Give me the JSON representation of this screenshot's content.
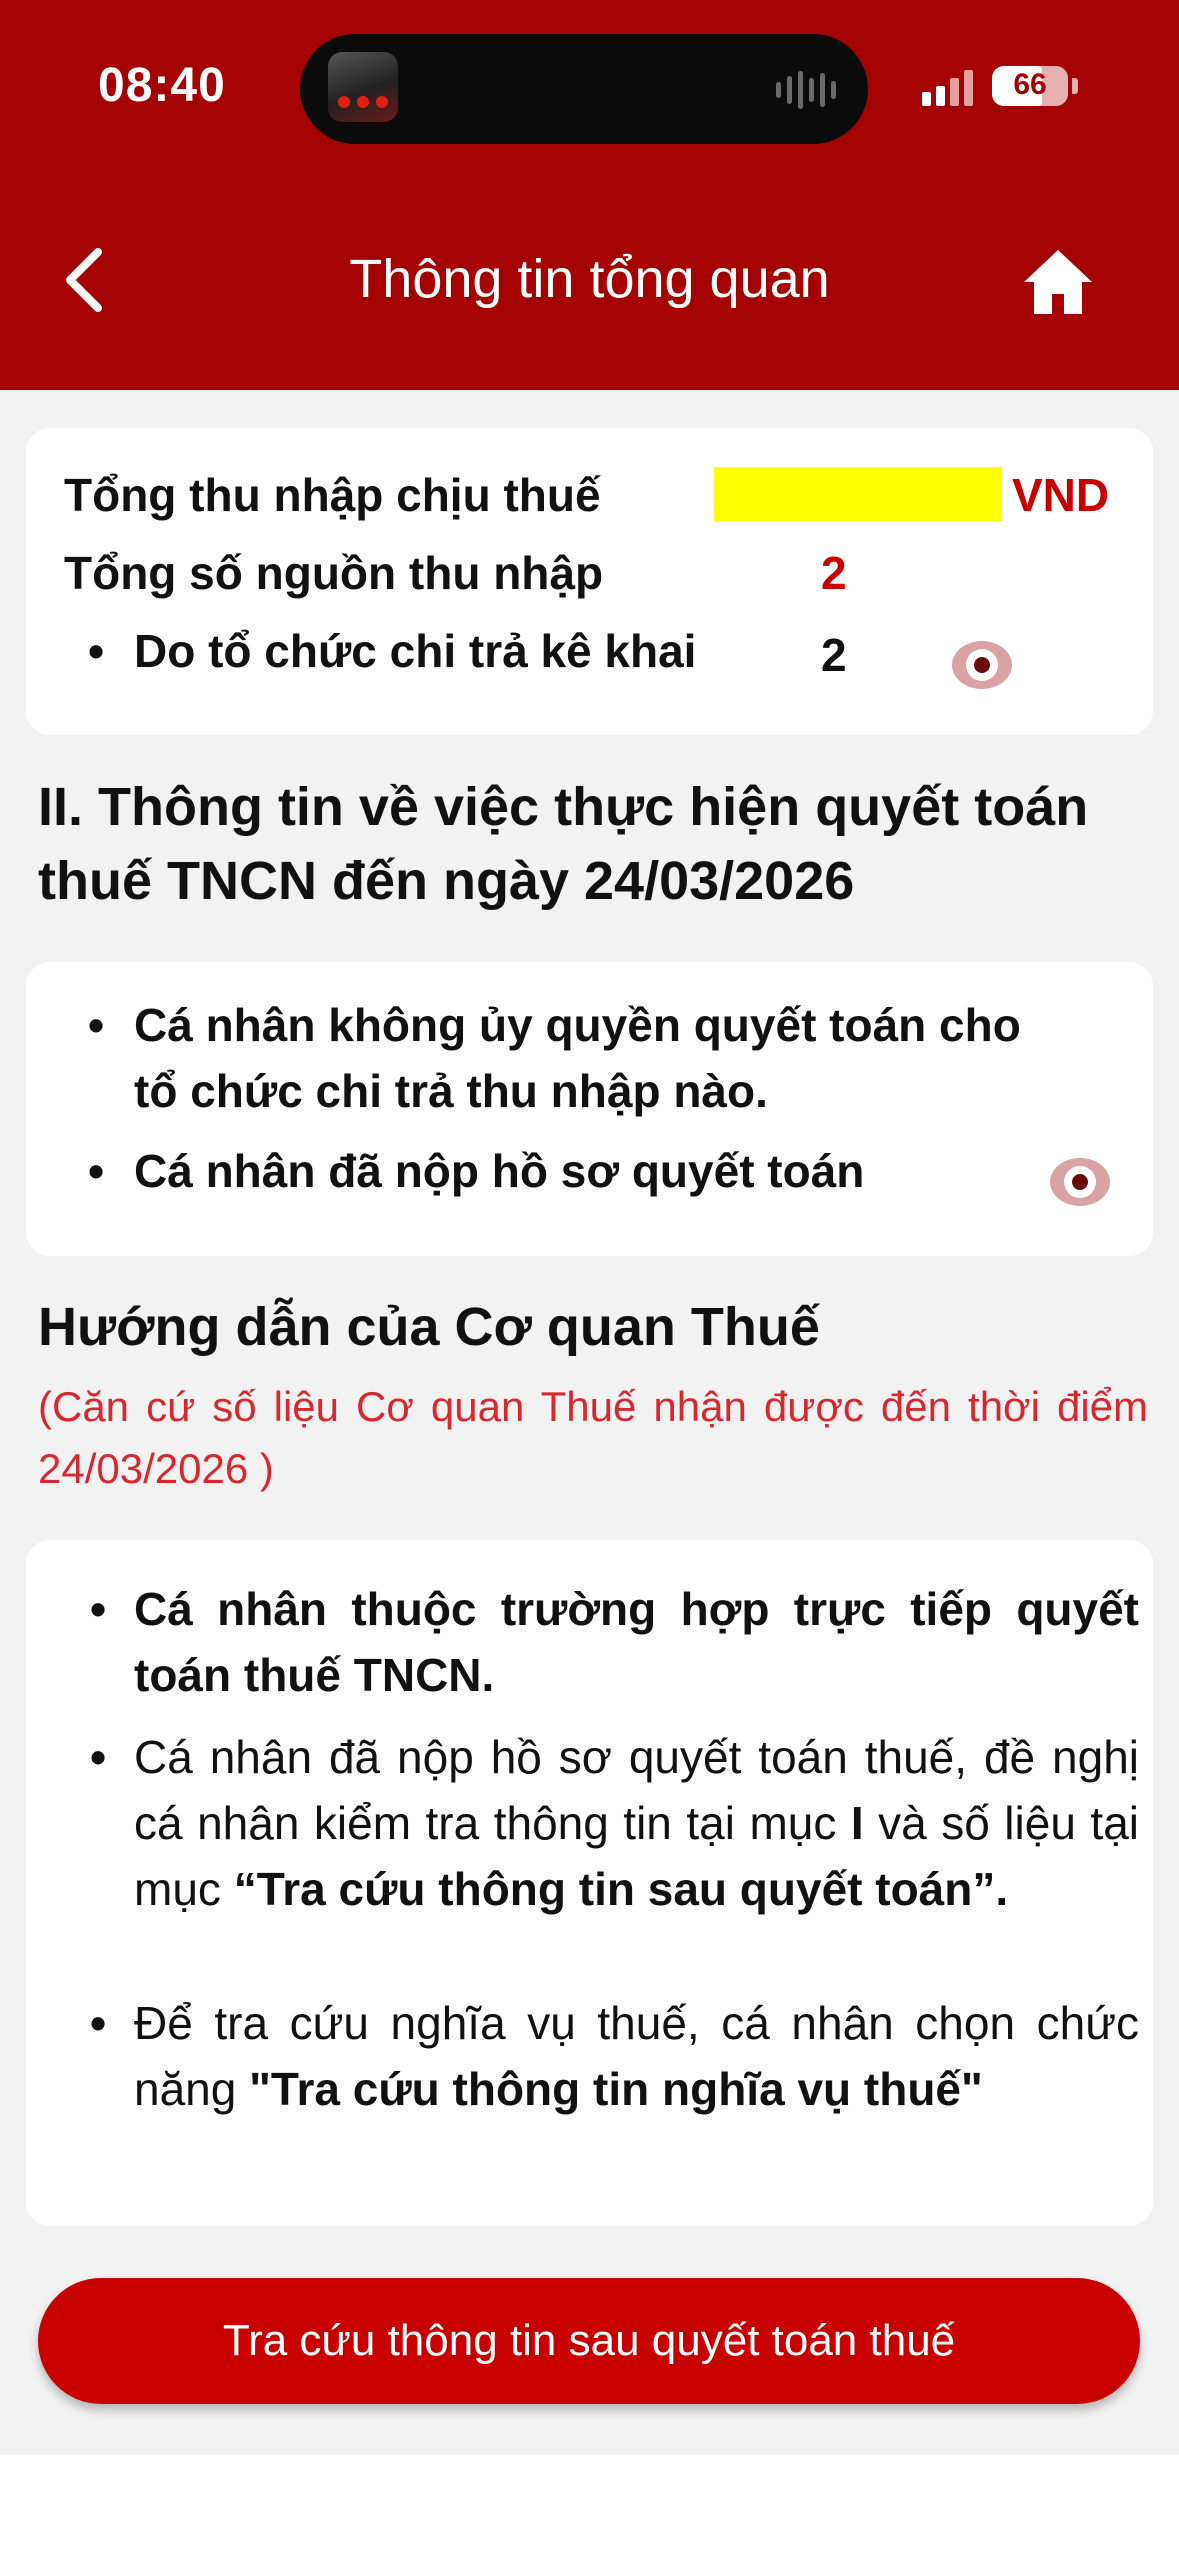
{
  "status_bar": {
    "time": "08:40",
    "battery": "66"
  },
  "header": {
    "title": "Thông tin tổng quan"
  },
  "summary": {
    "taxable_income_label": "Tổng thu nhập chịu thuế",
    "taxable_income_currency": "VND",
    "income_sources_label": "Tổng số nguồn thu nhập",
    "income_sources_value": "2",
    "declared_by_org_label": "Do tổ chức chi trả kê khai",
    "declared_by_org_value": "2"
  },
  "section2": {
    "title_line1": "II. Thông tin về việc thực hiện quyết toán",
    "title_line2": "thuế TNCN đến ngày 24/03/2026",
    "item1_line1": "Cá nhân không ủy quyền quyết toán cho",
    "item1_line2": "tổ chức chi trả thu nhập nào.",
    "item2": "Cá nhân đã nộp hồ sơ quyết toán"
  },
  "guidance": {
    "title": "Hướng dẫn của Cơ quan Thuế",
    "note": "(Căn cứ số liệu Cơ quan Thuế nhận được đến thời điểm 24/03/2026 )",
    "item1": "Cá nhân thuộc trường hợp trực tiếp quyết toán thuế TNCN.",
    "item2_text1": "Cá nhân đã nộp hồ sơ quyết toán thuế, đề nghị cá nhân kiểm tra thông tin tại mục ",
    "item2_bold1": "I",
    "item2_text2": " và số liệu tại mục ",
    "item2_bold2": "“Tra cứu thông tin sau quyết toán”.",
    "item3_text": "Để tra cứu nghĩa vụ thuế, cá nhân chọn chức năng ",
    "item3_bold": "\"Tra cứu thông tin nghĩa vụ thuế\""
  },
  "action_button": {
    "label": "Tra cứu thông tin sau quyết toán thuế"
  },
  "icons": [
    "back-arrow-icon",
    "home-icon",
    "eye-icon",
    "signal-icon",
    "battery-icon"
  ],
  "colors": {
    "brand_red": "#a50303",
    "accent_red": "#c90000",
    "highlight": "#ffff00"
  }
}
